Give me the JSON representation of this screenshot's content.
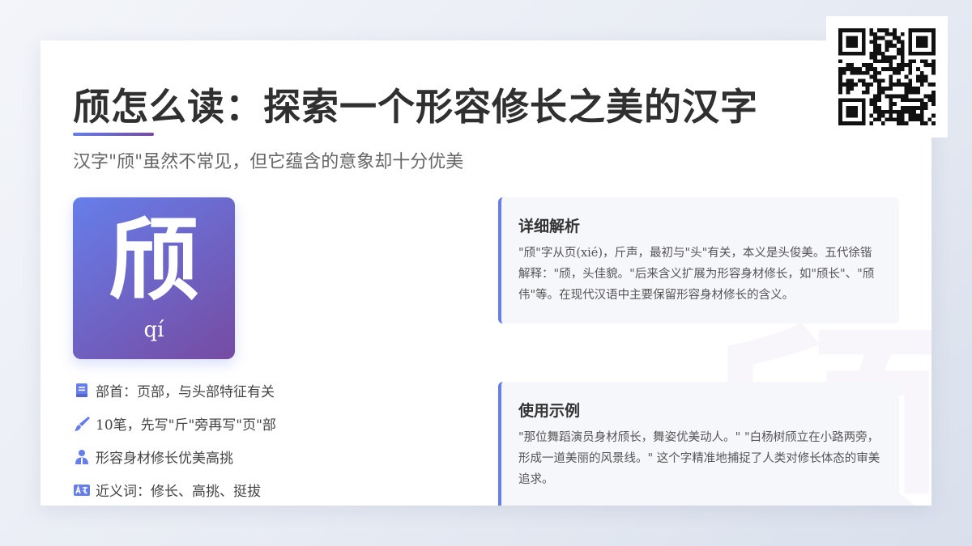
{
  "header": {
    "title": "颀怎么读：探索一个形容修长之美的汉字",
    "subtitle": "汉字\"颀\"虽然不常见，但它蕴含的意象却十分优美"
  },
  "character": {
    "glyph": "颀",
    "pinyin": "qí",
    "watermark": "颀"
  },
  "features": [
    {
      "icon": "book-icon",
      "text": "部首：页部，与头部特征有关"
    },
    {
      "icon": "brush-icon",
      "text": "10笔，先写\"斤\"旁再写\"页\"部"
    },
    {
      "icon": "person-icon",
      "text": "形容身材修长优美高挑"
    },
    {
      "icon": "translate-icon",
      "text": "近义词：修长、高挑、挺拔"
    }
  ],
  "sections": [
    {
      "heading": "详细解析",
      "body": "\"颀\"字从页(xié)，斤声，最初与\"头\"有关，本义是头俊美。五代徐锴解释：\"颀，头佳貌。\"后来含义扩展为形容身材修长，如\"颀长\"、\"颀伟\"等。在现代汉语中主要保留形容身材修长的含义。"
    },
    {
      "heading": "使用示例",
      "body": "\"那位舞蹈演员身材颀长，舞姿优美动人。\" \"白杨树颀立在小路两旁，形成一道美丽的风景线。\" 这个字精准地捕捉了人类对修长体态的审美追求。"
    }
  ],
  "colors": {
    "accent_start": "#667eea",
    "accent_end": "#764ba2",
    "title": "#303030",
    "body_text": "#555555"
  },
  "qr_code": {
    "icon": "qr-code-icon"
  }
}
